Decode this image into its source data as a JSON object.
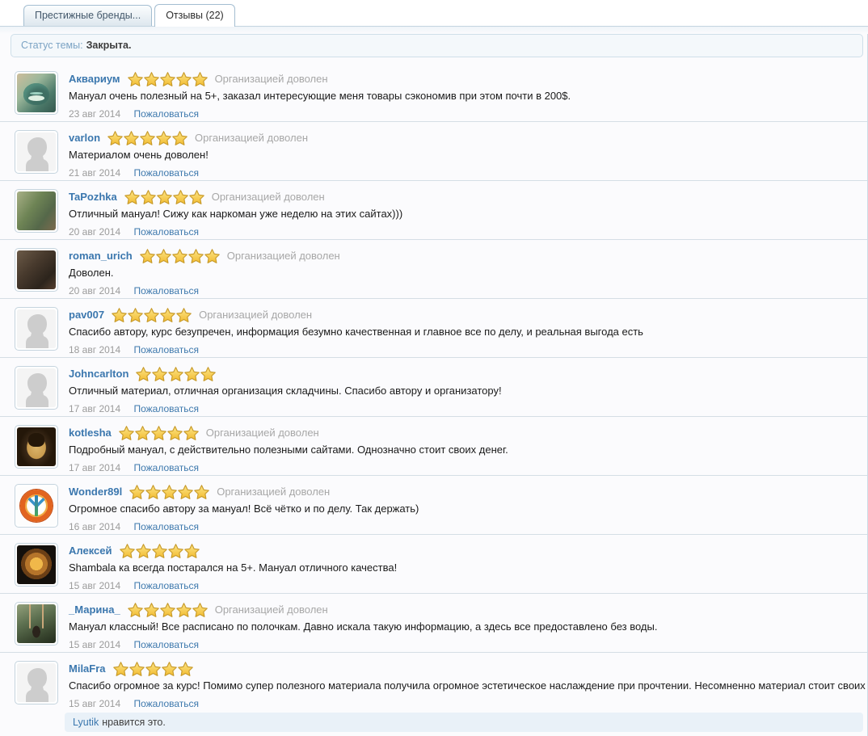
{
  "tabs": [
    {
      "label": "Престижные бренды...",
      "active": false
    },
    {
      "label": "Отзывы (22)",
      "active": true
    }
  ],
  "status": {
    "label": "Статус темы:",
    "value": "Закрыта."
  },
  "ui": {
    "report_label": "Пожаловаться"
  },
  "reviews": [
    {
      "username": "Аквариум",
      "rating": 5,
      "org_label": "Организацией доволен",
      "text": "Мануал очень полезный на 5+, заказал интересующие меня товары сэкономив при этом почти в 200$.",
      "date": "23 авг 2014",
      "avatar": "cheshire-cat-photo"
    },
    {
      "username": "varlon",
      "rating": 5,
      "org_label": "Организацией доволен",
      "text": "Материалом очень доволен!",
      "date": "21 авг 2014",
      "avatar": "default-silhouette"
    },
    {
      "username": "TaPozhka",
      "rating": 5,
      "org_label": "Организацией доволен",
      "text": "Отличный мануал! Сижу как наркоман уже неделю на этих сайтах)))",
      "date": "20 авг 2014",
      "avatar": "garden-photo"
    },
    {
      "username": "roman_urich",
      "rating": 5,
      "org_label": "Организацией доволен",
      "text": "Доволен.",
      "date": "20 авг 2014",
      "avatar": "dark-painting-photo"
    },
    {
      "username": "pav007",
      "rating": 5,
      "org_label": "Организацией доволен",
      "text": "Спасибо автору, курс безупречен, информация безумно качественная и главное все по делу, и реальная выгода есть",
      "date": "18 авг 2014",
      "avatar": "default-silhouette"
    },
    {
      "username": "Johncarlton",
      "rating": 5,
      "text": "Отличный материал, отличная организация складчины. Спасибо автору и организатору!",
      "date": "17 авг 2014",
      "avatar": "default-silhouette"
    },
    {
      "username": "kotlesha",
      "rating": 5,
      "org_label": "Организацией доволен",
      "text": "Подробный мануал, с действительно полезными сайтами. Однозначно стоит своих денег.",
      "date": "17 авг 2014",
      "avatar": "cat-suit-art"
    },
    {
      "username": "Wonder89l",
      "rating": 5,
      "org_label": "Организацией доволен",
      "text": "Огромное спасибо автору за мануал! Всё чётко и по делу. Так держать)",
      "date": "16 авг 2014",
      "avatar": "rainbow-peace-art"
    },
    {
      "username": "Алексей",
      "rating": 5,
      "text": "Shambala ка всегда постарался на 5+. Мануал отличного качества!",
      "date": "15 авг 2014",
      "avatar": "lion-art"
    },
    {
      "username": "_Марина_",
      "rating": 5,
      "org_label": "Организацией доволен",
      "text": "Мануал классный! Все расписано по полочкам. Давно искала такую информацию, а здесь все предоставлено без воды.",
      "date": "15 авг 2014",
      "avatar": "swing-photo"
    },
    {
      "username": "MilaFra",
      "rating": 5,
      "text": "Спасибо огромное за курс! Помимо супер полезного материала получила огромное эстетическое наслаждение при прочтении. Несомненно материал стоит своих денег!",
      "date": "15 авг 2014",
      "avatar": "default-silhouette"
    }
  ],
  "likes": {
    "user": "Lyutik",
    "suffix": "нравится это."
  },
  "colors": {
    "link_blue": "#3b77ae",
    "star_gold": "#f2bb30",
    "star_edge": "#c79a2a",
    "status_bg": "#f4f8fb",
    "likes_bg": "#e9f1f8",
    "divider": "#d5dee5",
    "org_label_gray": "#a7a7a7"
  }
}
